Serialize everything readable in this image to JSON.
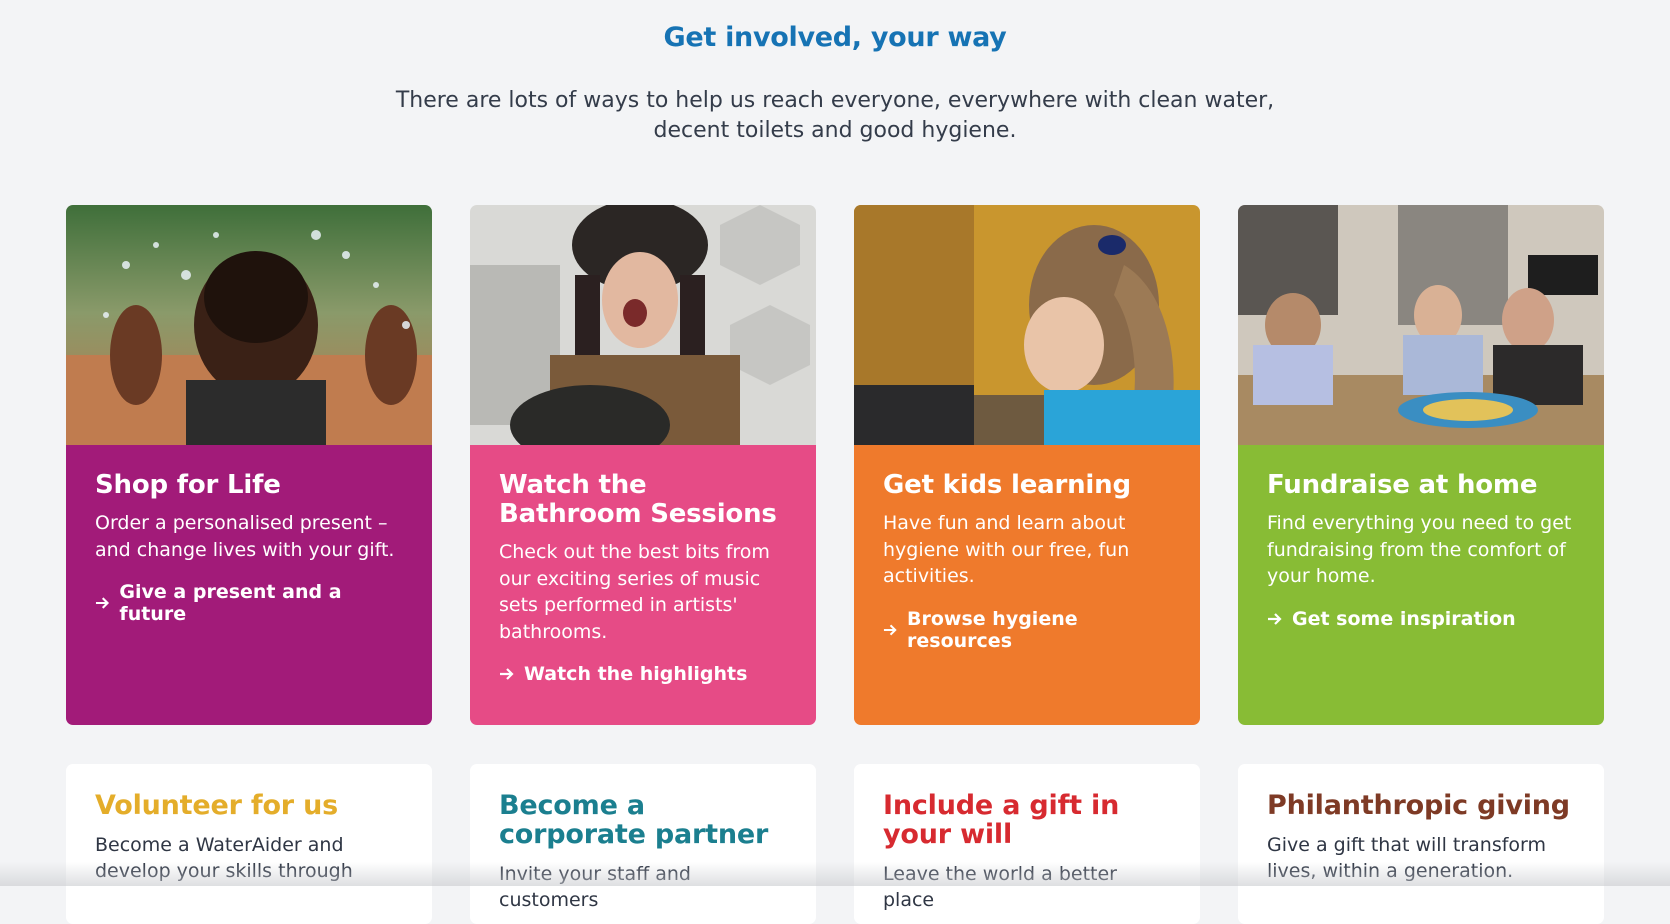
{
  "section": {
    "title": "Get involved, your way",
    "intro": "There are lots of ways to help us reach everyone, everywhere with clean water, decent toilets and good hygiene."
  },
  "colors": {
    "heading": "#1673b4",
    "shop_card": "#a21b79",
    "bathroom_card": "#e64b86",
    "kids_card": "#ef7a2c",
    "fundraise_card": "#88bc35",
    "volunteer_title": "#e4ad2a",
    "corporate_title": "#1b7f8f",
    "will_title": "#d72a30",
    "philanthropic_title": "#7e3a25"
  },
  "cards": [
    {
      "title": "Shop for Life",
      "text": "Order a personalised present – and change lives with your gift.",
      "link": "Give a present and a future",
      "image": "child-splashing-water-photo"
    },
    {
      "title": "Watch the Bathroom Sessions",
      "text": "Check out the best bits from our exciting series of music sets performed in artists' bathrooms.",
      "link": "Watch the highlights",
      "image": "singer-with-guitar-photo"
    },
    {
      "title": "Get kids learning",
      "text": "Have fun and learn about hygiene with our free, fun activities.",
      "link": "Browse hygiene resources",
      "image": "girl-at-laptop-photo"
    },
    {
      "title": "Fundraise at home",
      "text": "Find everything you need to get fundraising from the comfort of your home.",
      "link": "Get some inspiration",
      "image": "people-playing-board-game-photo"
    }
  ],
  "secondary_cards": [
    {
      "title": "Volunteer for us",
      "text": "Become a WaterAider and develop your skills through"
    },
    {
      "title": "Become a corporate partner",
      "text": "Invite your staff and customers"
    },
    {
      "title": "Include a gift in your will",
      "text": "Leave the world a better place"
    },
    {
      "title": "Philanthropic giving",
      "text": "Give a gift that will transform lives, within a generation."
    }
  ]
}
